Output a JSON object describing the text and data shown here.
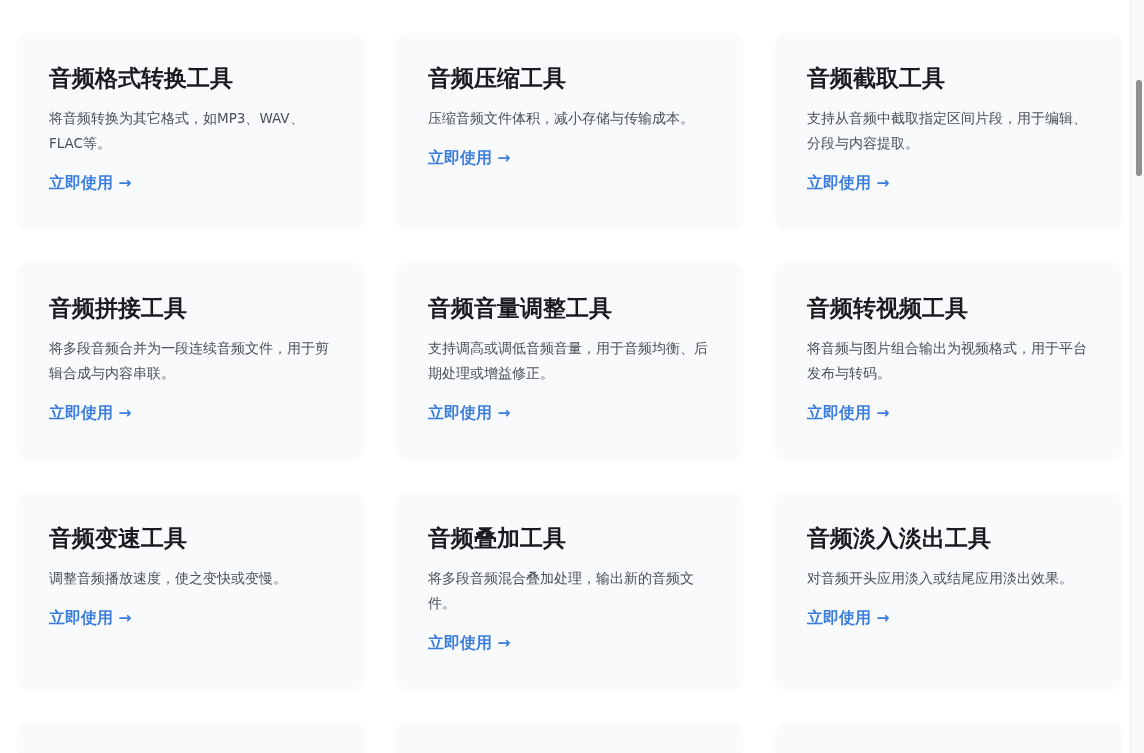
{
  "tools": [
    {
      "title": "音频格式转换工具",
      "description": "将音频转换为其它格式，如MP3、WAV、FLAC等。",
      "link": "立即使用 →"
    },
    {
      "title": "音频压缩工具",
      "description": "压缩音频文件体积，减小存储与传输成本。",
      "link": "立即使用 →"
    },
    {
      "title": "音频截取工具",
      "description": "支持从音频中截取指定区间片段，用于编辑、分段与内容提取。",
      "link": "立即使用 →"
    },
    {
      "title": "音频拼接工具",
      "description": "将多段音频合并为一段连续音频文件，用于剪辑合成与内容串联。",
      "link": "立即使用 →"
    },
    {
      "title": "音频音量调整工具",
      "description": "支持调高或调低音频音量，用于音频均衡、后期处理或增益修正。",
      "link": "立即使用 →"
    },
    {
      "title": "音频转视频工具",
      "description": "将音频与图片组合输出为视频格式，用于平台发布与转码。",
      "link": "立即使用 →"
    },
    {
      "title": "音频变速工具",
      "description": "调整音频播放速度，使之变快或变慢。",
      "link": "立即使用 →"
    },
    {
      "title": "音频叠加工具",
      "description": "将多段音频混合叠加处理，输出新的音频文件。",
      "link": "立即使用 →"
    },
    {
      "title": "音频淡入淡出工具",
      "description": "对音频开头应用淡入或结尾应用淡出效果。",
      "link": "立即使用 →"
    }
  ],
  "partial_cards": [
    {
      "kind": "blank"
    },
    {
      "kind": "blank"
    },
    {
      "kind": "blank"
    }
  ]
}
